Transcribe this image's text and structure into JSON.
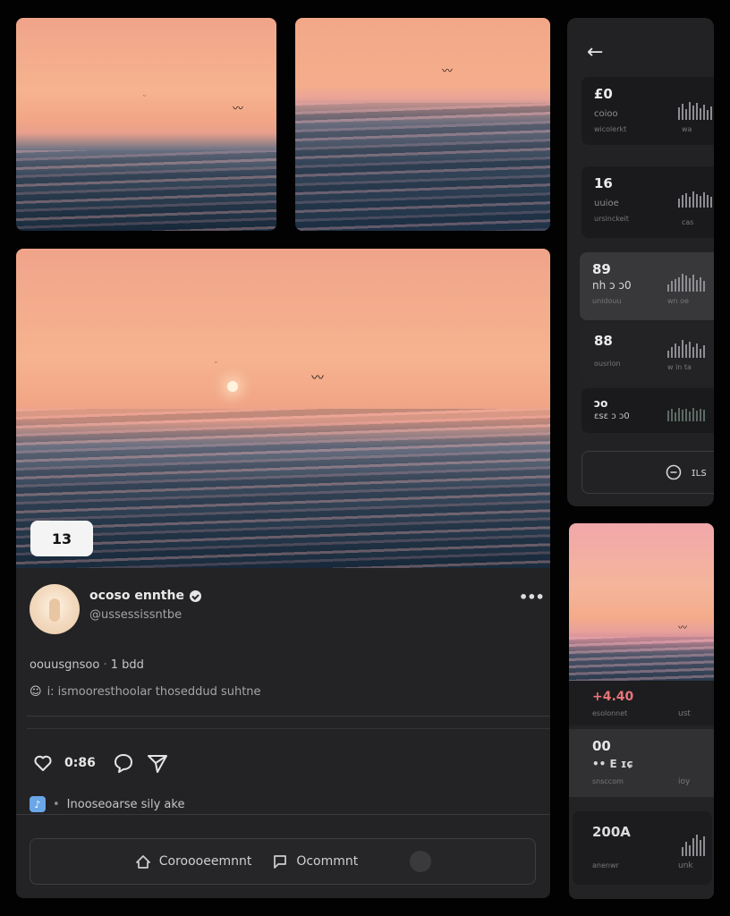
{
  "tiles": {
    "top_left": {
      "alt": "sunset-sea-photo"
    },
    "top_right": {
      "alt": "sunset-sea-photo"
    }
  },
  "post": {
    "image_counter": "13",
    "author_name": "ocoso ennthe",
    "author_handle": "@ussessissntbe",
    "more_label": "•••",
    "meta_text": "oouusgnsoo",
    "meta_sep": "·",
    "meta_time": "1 bdd",
    "caption": "i: ismooresthoolar thoseddud suhtne",
    "like_count": "0:86",
    "music_text": "Inooseoarse sily ake",
    "connect_label": "Coroooeemnnt",
    "comment_label": "Ocommnt"
  },
  "panel": {
    "back_label": "←",
    "cards": [
      {
        "value": "£0",
        "label": "coioo",
        "sub": "wicolerkt",
        "right": "wa"
      },
      {
        "value": "16",
        "label": "uuioe",
        "sub": "ursinckeit",
        "right": "cas"
      },
      {
        "value": "89",
        "label": "nh ɔ ɔ0",
        "sub": "unidouu",
        "right": "wn oe"
      },
      {
        "value": "88",
        "label": "",
        "sub": "ousrion",
        "right": "w in ta"
      },
      {
        "value": "ɔo",
        "label": "ɛsɛ ɔ ɔ0",
        "sub": "",
        "right": ""
      }
    ],
    "button_label": "ɪʟs"
  },
  "mini": {
    "stats": [
      {
        "value": "+4.40",
        "sub": "esolonnet",
        "right": "ust"
      },
      {
        "value": "00",
        "value2": "•• E ɪɕ",
        "sub": "snsccom",
        "right": "ioy"
      },
      {
        "value": "200A",
        "sub": "anenwr",
        "right": "unk"
      }
    ]
  },
  "colors": {
    "accent_red": "#e8747a",
    "background": "#020202",
    "card": "#232325"
  }
}
